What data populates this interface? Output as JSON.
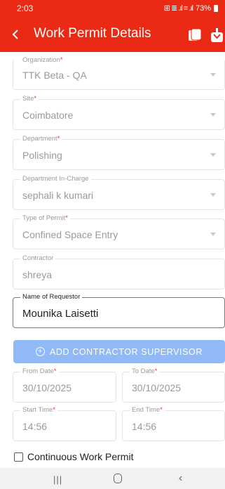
{
  "status_bar": {
    "time": "2:03",
    "icons_text": "⊞ ≣ .ıl ≡ .ıl",
    "battery": "73%"
  },
  "app_bar": {
    "title": "Work Permit Details",
    "back_icon": "chevron-left-icon",
    "actions": [
      "copy-icon",
      "download-icon"
    ]
  },
  "form": {
    "organization": {
      "label": "Organization",
      "required": "*",
      "value": "TTK Beta - QA"
    },
    "site": {
      "label": "Site",
      "required": "*",
      "value": "Coimbatore"
    },
    "department": {
      "label": "Department",
      "required": "*",
      "value": "Polishing"
    },
    "department_in_charge": {
      "label": "Department In-Charge",
      "value": "sephali k kumari"
    },
    "type_of_permit": {
      "label": "Type of Permit",
      "required": "*",
      "value": "Confined Space Entry"
    },
    "contractor": {
      "label": "Contractor",
      "value": "shreya"
    },
    "name_of_requestor": {
      "label": "Name of Requestor",
      "value": "Mounika Laisetti"
    },
    "add_contractor_supervisor": "ADD CONTRACTOR SUPERVISOR",
    "from_date": {
      "label": "From Date",
      "required": "*",
      "value": "30/10/2025"
    },
    "to_date": {
      "label": "To Date",
      "required": "*",
      "value": "30/10/2025"
    },
    "start_time": {
      "label": "Start Time",
      "required": "*",
      "value": "14:56"
    },
    "end_time": {
      "label": "End Time",
      "required": "*",
      "value": "14:56"
    },
    "continuous_work_permit": {
      "label": "Continuous Work Permit",
      "checked": false
    }
  },
  "colors": {
    "primary": "#ea2a14",
    "button": "#91b9f6",
    "required": "#e53935"
  }
}
